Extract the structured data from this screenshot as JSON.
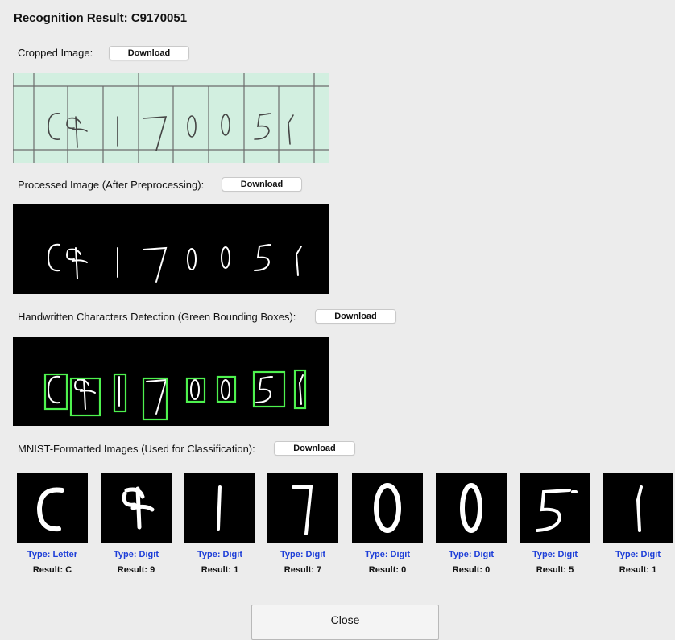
{
  "title": "Recognition Result: C9170051",
  "sections": {
    "cropped": {
      "label": "Cropped Image:",
      "button": "Download"
    },
    "processed": {
      "label": "Processed Image (After Preprocessing):",
      "button": "Download"
    },
    "detection": {
      "label": "Handwritten Characters Detection (Green Bounding Boxes):",
      "button": "Download"
    },
    "mnist": {
      "label": "MNIST-Formatted Images (Used for Classification):",
      "button": "Download"
    }
  },
  "characters": [
    {
      "type": "Type: Letter",
      "result": "Result: C"
    },
    {
      "type": "Type: Digit",
      "result": "Result: 9"
    },
    {
      "type": "Type: Digit",
      "result": "Result: 1"
    },
    {
      "type": "Type: Digit",
      "result": "Result: 7"
    },
    {
      "type": "Type: Digit",
      "result": "Result: 0"
    },
    {
      "type": "Type: Digit",
      "result": "Result: 0"
    },
    {
      "type": "Type: Digit",
      "result": "Result: 5"
    },
    {
      "type": "Type: Digit",
      "result": "Result: 1"
    }
  ],
  "close_button": "Close",
  "colors": {
    "background": "#ececec",
    "type_label": "#1e3fd8",
    "bounding_box": "#4ef24e",
    "cropped_paper": "#d2efe0"
  }
}
